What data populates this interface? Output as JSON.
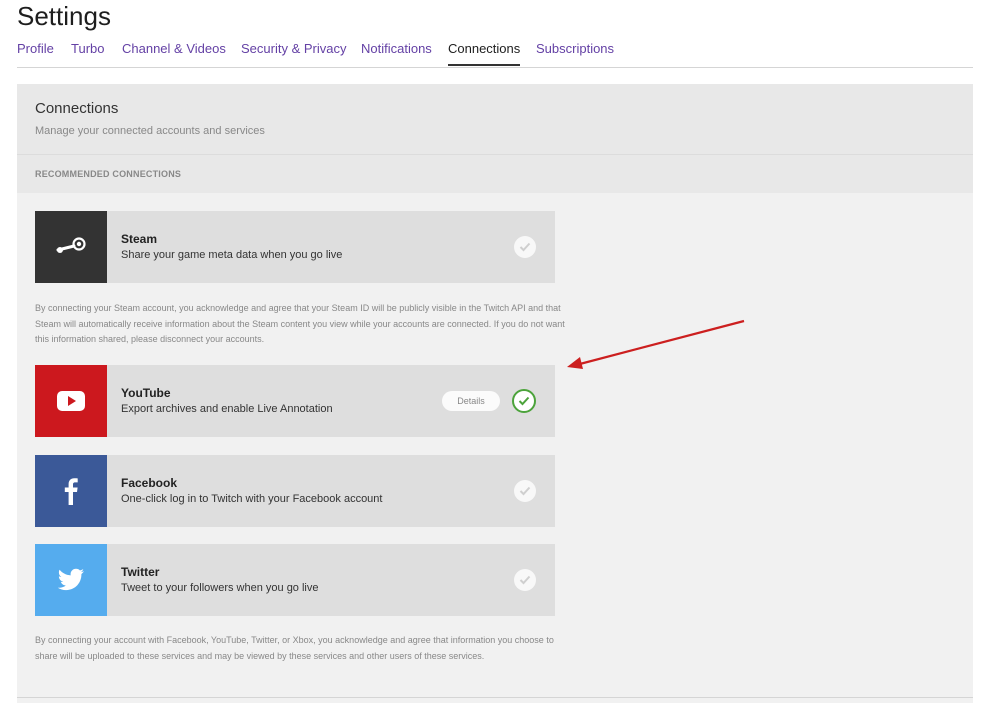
{
  "page": {
    "title": "Settings"
  },
  "tabs": [
    {
      "label": "Profile"
    },
    {
      "label": "Turbo"
    },
    {
      "label": "Channel & Videos"
    },
    {
      "label": "Security & Privacy"
    },
    {
      "label": "Notifications"
    },
    {
      "label": "Connections",
      "active": true
    },
    {
      "label": "Subscriptions"
    }
  ],
  "panel": {
    "title": "Connections",
    "subtitle": "Manage your connected accounts and services",
    "section_label": "RECOMMENDED CONNECTIONS"
  },
  "connections": [
    {
      "name": "Steam",
      "description": "Share your game meta data when you go live",
      "icon": "steam-icon",
      "color": "#333333",
      "connected": false
    },
    {
      "name": "YouTube",
      "description": "Export archives and enable Live Annotation",
      "icon": "youtube-play-icon",
      "color": "#cc181e",
      "connected": true,
      "details_label": "Details"
    },
    {
      "name": "Facebook",
      "description": "One-click log in to Twitch with your Facebook account",
      "icon": "facebook-icon",
      "color": "#3b5998",
      "connected": false
    },
    {
      "name": "Twitter",
      "description": "Tweet to your followers when you go live",
      "icon": "twitter-bird-icon",
      "color": "#55acee",
      "connected": false
    }
  ],
  "notices": {
    "steam": "By connecting your Steam account, you acknowledge and agree that your Steam ID will be publicly visible in the Twitch API and that Steam will automatically receive information about the Steam content you view while your accounts are connected. If you do not want this information shared, please disconnect your accounts.",
    "general": "By connecting your account with Facebook, YouTube, Twitter, or Xbox, you acknowledge and agree that information you choose to share will be uploaded to these services and may be viewed by these services and other users of these services."
  },
  "colors": {
    "accent": "#6441a5",
    "connected_green": "#4ca33b",
    "annotation_arrow": "#cc1f1f"
  }
}
